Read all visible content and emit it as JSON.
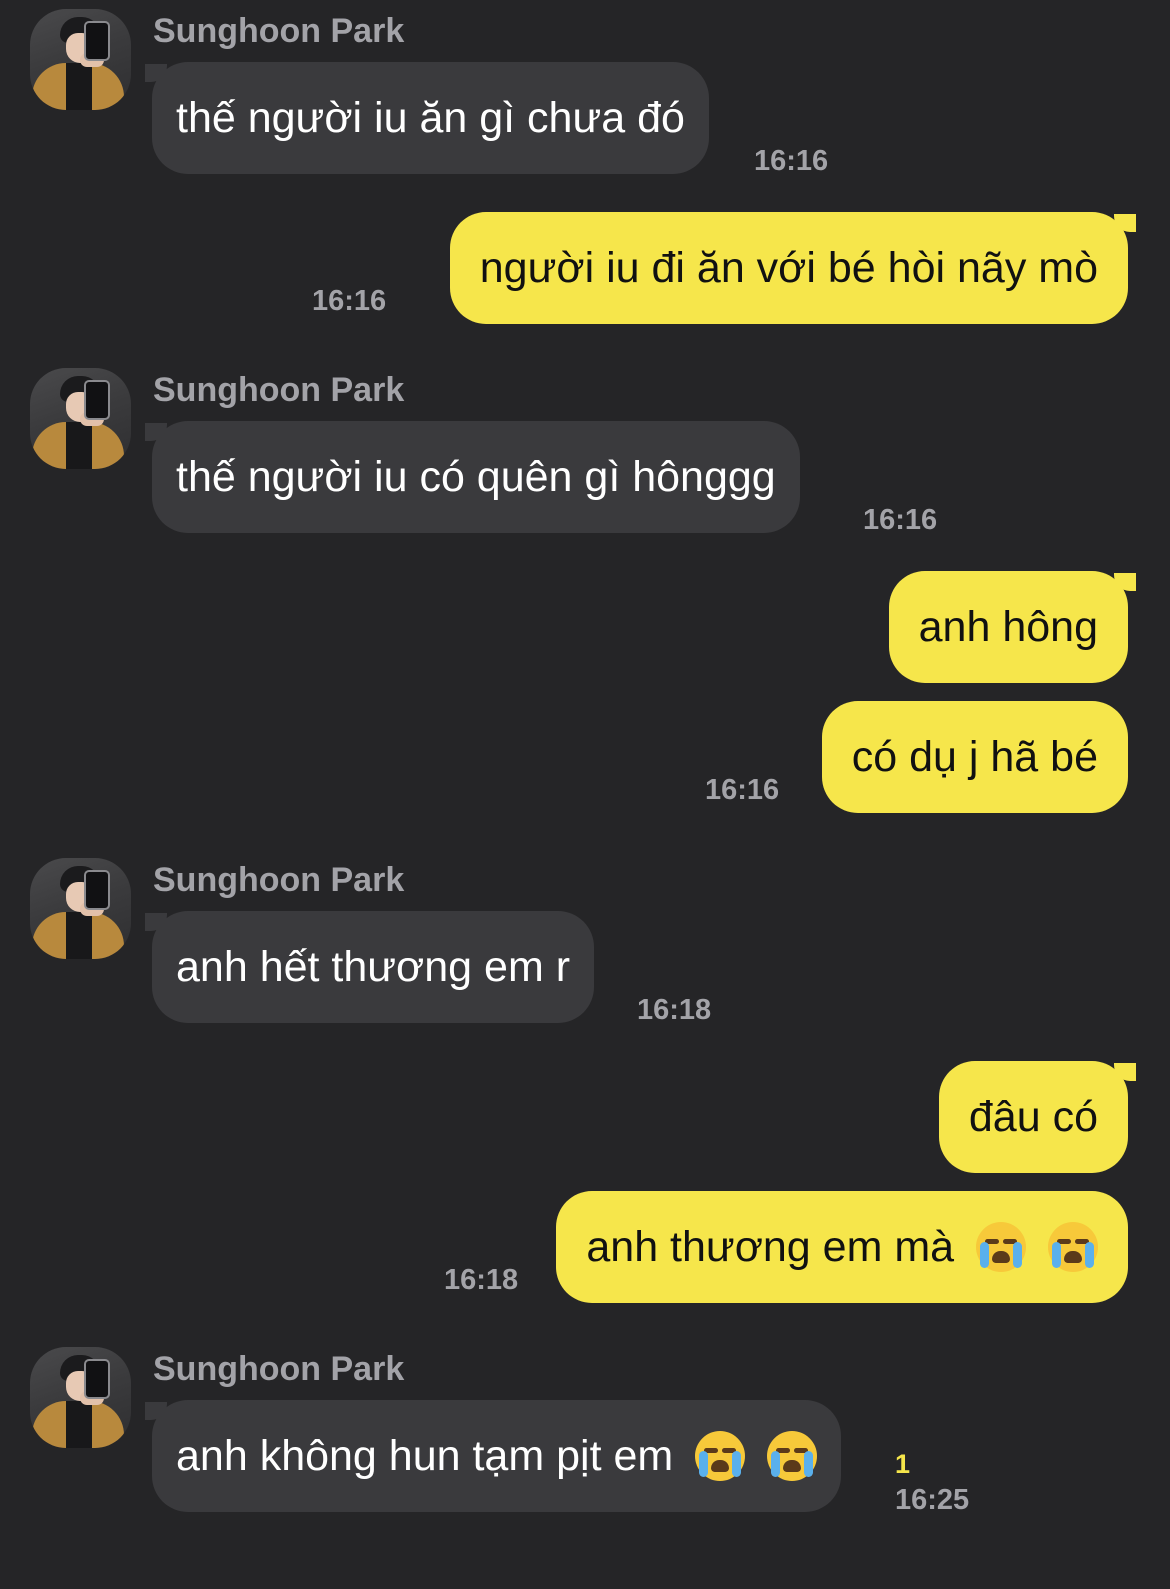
{
  "contact_name": "Sunghoon Park",
  "unread_count": "1",
  "messages": [
    {
      "text": "thế người iu ăn gì chưa đó",
      "time": "16:16"
    },
    {
      "text": "người iu đi ăn với bé hòi nãy mò",
      "time": "16:16"
    },
    {
      "text": "thế người iu có quên gì hônggg",
      "time": "16:16"
    },
    {
      "text": "anh hông"
    },
    {
      "text": "có dụ j hã bé",
      "time": "16:16"
    },
    {
      "text": "anh hết thương em r",
      "time": "16:18"
    },
    {
      "text": "đâu có"
    },
    {
      "text": "anh thương em mà",
      "emoji": [
        "loudly-crying-face-icon",
        "loudly-crying-face-icon"
      ],
      "time": "16:18"
    },
    {
      "text": "anh không hun tạm pịt em",
      "emoji": [
        "loudly-crying-face-icon",
        "loudly-crying-face-icon"
      ],
      "time": "16:25"
    }
  ]
}
